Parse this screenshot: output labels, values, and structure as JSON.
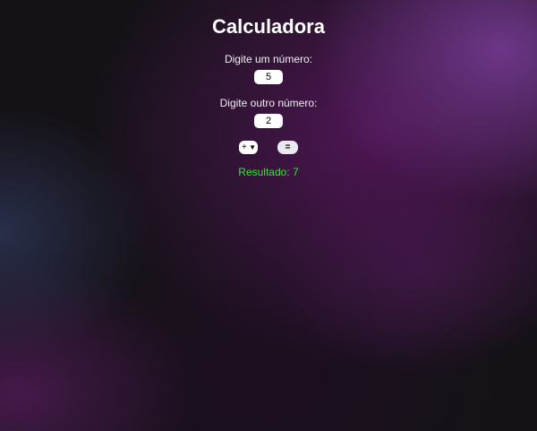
{
  "page": {
    "title": "Calculadora"
  },
  "form": {
    "first_label": "Digite um número:",
    "first_value": "5",
    "second_label": "Digite outro número:",
    "second_value": "2",
    "operator_selected": "+",
    "equals_label": "="
  },
  "result": {
    "text": "Resultado: 7"
  },
  "icons": {
    "operator_dropdown": "chevron-down-icon"
  },
  "colors": {
    "result_text": "#34e634",
    "background_accent": "#70388c"
  }
}
